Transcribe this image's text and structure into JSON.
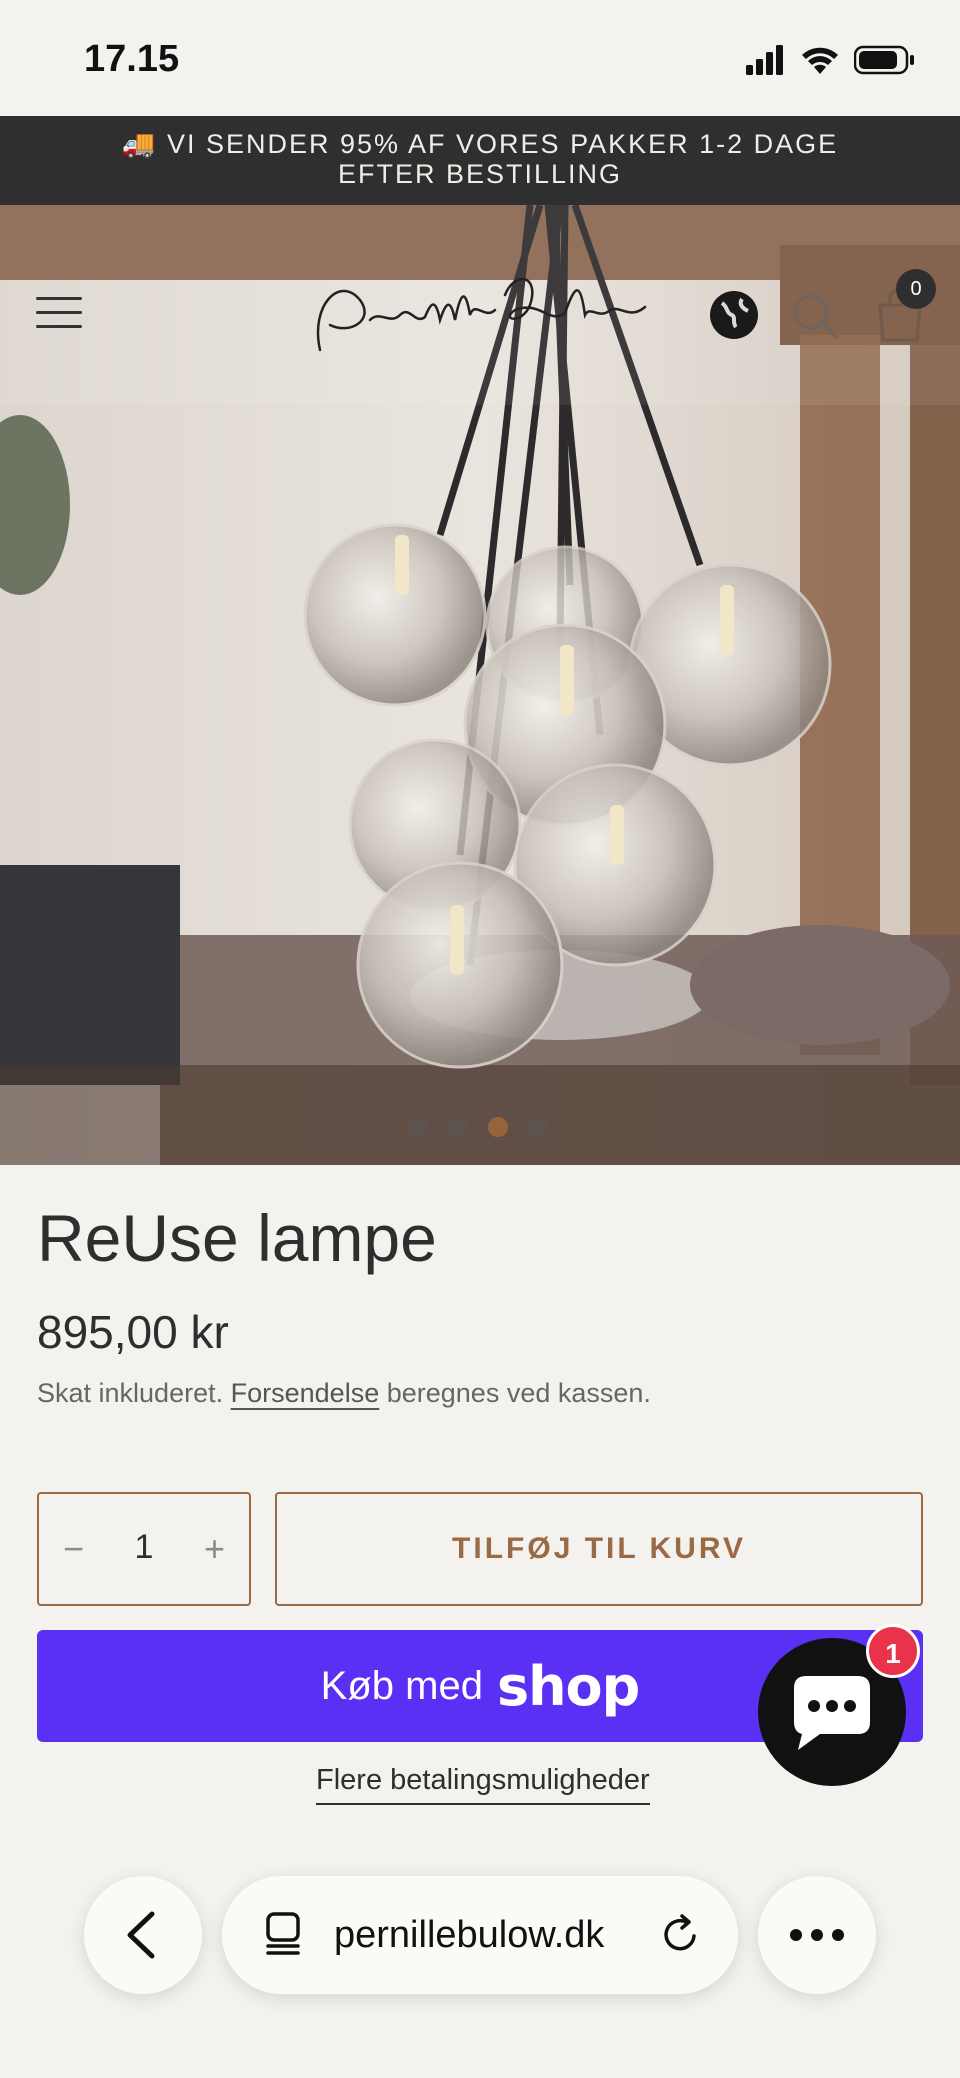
{
  "status_bar": {
    "time": "17.15"
  },
  "announcement": {
    "line1": "🚚 VI SENDER 95% AF VORES PAKKER 1-2 DAGE",
    "line2": "EFTER BESTILLING"
  },
  "header": {
    "logo_text": "Pernille Bülow",
    "cart_count": "0"
  },
  "gallery": {
    "slides": 4,
    "active_slide": 3
  },
  "product": {
    "title": "ReUse lampe",
    "price": "895,00 kr",
    "tax_prefix": "Skat inkluderet.",
    "shipping_link": "Forsendelse",
    "tax_suffix": "beregnes ved kassen."
  },
  "purchase": {
    "qty_minus": "−",
    "qty_value": "1",
    "qty_plus": "+",
    "add_to_cart": "TILFØJ TIL KURV",
    "shop_pay_label": "Køb med",
    "shop_pay_brand": "shop",
    "more_payment": "Flere betalingsmuligheder"
  },
  "chat": {
    "badge": "1"
  },
  "browser": {
    "url": "pernillebulow.dk"
  },
  "colors": {
    "accent": "#9b6a45",
    "shop_pay": "#5a31f4",
    "banner": "#2f2f2f",
    "badge": "#e8334a"
  }
}
